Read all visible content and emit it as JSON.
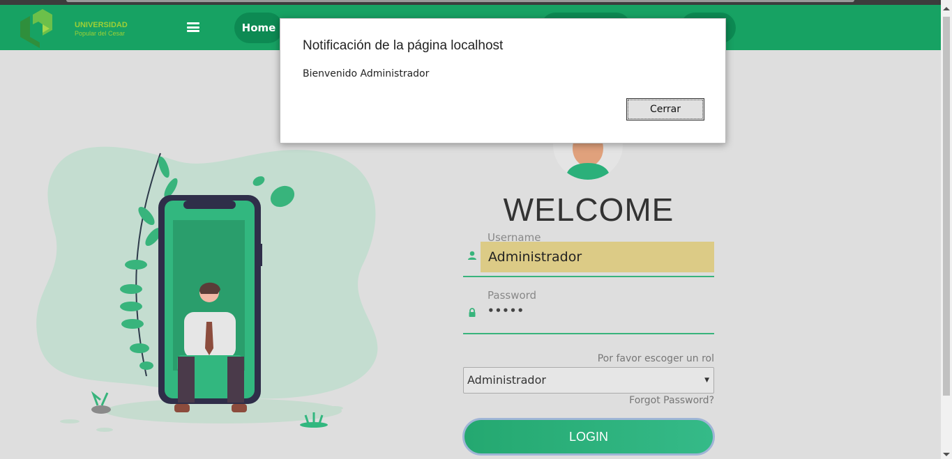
{
  "navbar": {
    "logo_line1": "UNIVERSIDAD",
    "logo_line2": "Popular del Cesar",
    "home_label": "Home"
  },
  "login": {
    "welcome": "WELCOME",
    "username_label": "Username",
    "username_value": "Administrador",
    "password_label": "Password",
    "password_value": "•••••",
    "role_prompt": "Por favor escoger un rol",
    "role_selected": "Administrador",
    "forgot_link": "Forgot Password?",
    "login_button": "LOGIN"
  },
  "dialog": {
    "title": "Notificación de la página localhost",
    "message": "Bienvenido Administrador",
    "close_button": "Cerrar"
  },
  "colors": {
    "primary": "#17a263",
    "accent": "#38b47c",
    "autofill": "#dccb86"
  },
  "icons": {
    "menu": "hamburger-icon",
    "user": "user-icon",
    "lock": "lock-icon"
  }
}
